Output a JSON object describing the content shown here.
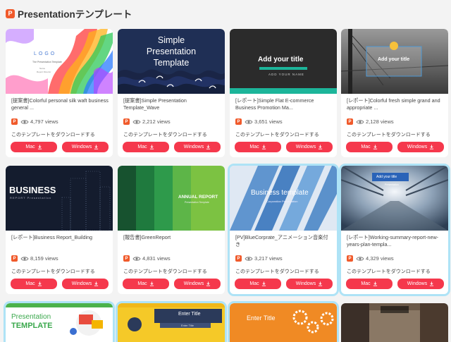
{
  "header": {
    "logo_letter": "P",
    "title": "Presentationテンプレート"
  },
  "common": {
    "download_text": "このテンプレートをダウンロードする",
    "mac_label": "Mac",
    "windows_label": "Windows"
  },
  "cards": [
    {
      "title": "[提案書]Colorful personal silk waft business general ...",
      "views": "4,797 views",
      "thumb": {
        "logo": "LOGO",
        "sub1": "The Presentation Template",
        "sub2": "Name",
        "sub3": "Report Director"
      }
    },
    {
      "title": "[提案書]Simple Presentation Template_Wave",
      "views": "2,212 views",
      "thumb": {
        "line1": "Simple",
        "line2": "Presentation",
        "line3": "Template"
      }
    },
    {
      "title": "[レポート]Simple Flat E-commerce Business Promotion Ma...",
      "views": "3,651 views",
      "thumb": {
        "heading": "Add your title",
        "sub": "ADD YOUR NAME"
      }
    },
    {
      "title": "[レポート]Colorful fresh simple grand and appropriate ...",
      "views": "2,128 views",
      "thumb": {
        "heading": "Add your title"
      }
    },
    {
      "title": "[レポート]Business Report_Building",
      "views": "8,159 views",
      "thumb": {
        "heading": "BUSINESS",
        "sub": "REPORT Presentation"
      }
    },
    {
      "title": "[報告書]GreenReport",
      "views": "4,831 views",
      "thumb": {
        "heading": "ANNUAL REPORT",
        "sub": "Presentation Template"
      }
    },
    {
      "title": "[PV]BlueCorprate_アニメーション音楽付き",
      "views": "3,217 views",
      "thumb": {
        "heading": "Business template",
        "sub": "Corporation Presentation"
      }
    },
    {
      "title": "[レポート]Working-summary-report-new-years-plan-templa...",
      "views": "4,329 views",
      "thumb": {
        "heading": "Add your title",
        "sub": "Presentation"
      }
    }
  ],
  "partial": [
    {
      "line1": "Presentation",
      "line2": "TEMPLATE"
    },
    {
      "heading": "Enter Title",
      "sub": "Enter Title"
    },
    {
      "heading": "Enter Title"
    },
    {
      "heading": ""
    }
  ]
}
